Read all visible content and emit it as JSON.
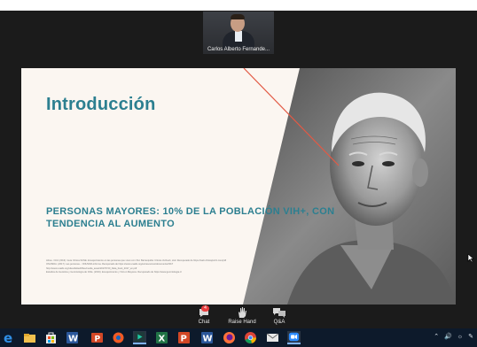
{
  "participant": {
    "name": "Carlos Alberto Fernande..."
  },
  "slide": {
    "title": "Introducción",
    "subtitle": "PERSONAS MAYORES: 10% DE LA POBLACIÓN VIH+, CON TENDENCIA AL AUMENTO",
    "references": [
      "Abreu. Ortiz (2013). Guía Clínica SUNE. Envejecimiento en las personas que viven con VIH. Barranquilla: Clínica Verhoeb, 2ed. Recuperado de https://web.clinicajrortiz.com/pdf",
      "ONUSIDA. (2017). Las personas... ONUSIDA informa. Recuperado de https://www.unaids.org/es/resources/documents/2017",
      "http://www.unaids.org/sites/default/files/media_asset/20170720_Data_book_2017_en.pdf",
      "Estudios de Genética y Gerontología de Chile. (2019). Envejecimiento y VIH en Mayores. Recuperado de https://www.gerontologia.cl"
    ]
  },
  "controls": {
    "chat_label": "Chat",
    "chat_badge": "4",
    "raise_hand_label": "Raise Hand",
    "qa_label": "Q&A"
  },
  "taskbar": {
    "apps": [
      "edge-icon",
      "file-explorer-icon",
      "store-icon",
      "word-icon",
      "powerpoint-icon",
      "media-player-icon",
      "excel-icon",
      "powerpoint-icon",
      "word-icon",
      "firefox-icon",
      "chrome-icon",
      "mail-icon",
      "zoom-icon"
    ],
    "tray_icons": [
      "chevron-up-icon",
      "volume-icon",
      "network-icon",
      "pen-icon"
    ]
  },
  "colors": {
    "title": "#2c7f90",
    "slide_background": "#fbf6f1",
    "accent_line": "#e25a45",
    "taskbar": "#0d1a2b"
  }
}
